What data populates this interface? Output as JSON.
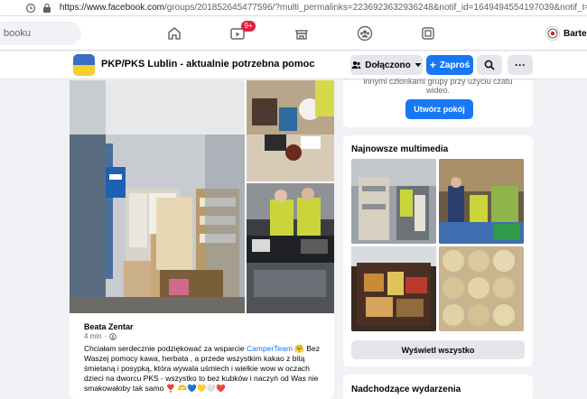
{
  "browser": {
    "url_prefix": "https://www.facebook.com",
    "url_rest": "/groups/201852645477596/?multi_permalinks=2236923632936248&notif_id=1649494554197039&notif_t=group_activity&ref=notif",
    "icons": [
      "history-icon",
      "lock-icon"
    ]
  },
  "topnav": {
    "search_placeholder": "booku",
    "watch_badge": "9+",
    "profile_name": "Bartek"
  },
  "group": {
    "title": "PKP/PKS Lublin - aktualnie potrzebna pomoc",
    "flag_colors": [
      "#3b6cc6",
      "#f5cf2a"
    ],
    "joined_label": "Dołączono",
    "invite_label": "Zaproś"
  },
  "post": {
    "author": "Beata Zentar",
    "time": "4 min",
    "text_before": "Chciałam serdecznie podziękować za wsparcie ",
    "mention": "CamperTeam",
    "text_after": " 🤗 Bez Waszej pomocy kawa, herbata , a przede wszystkim kakao z bitą śmietaną i posypką,  która wywala uśmiech i wielkie wow w oczach dzieci na dworcu PKS -  wszystko to bez kubków i naczyń od Was nie smakowałoby tak samo ",
    "hearts": "❣️ 🫶💙💛🤍❤️"
  },
  "sidebar": {
    "room_text_line1": "innymi członkami grupy przy użyciu czatu",
    "room_text_line2": "wideo.",
    "room_button": "Utwórz pokój",
    "media_title": "Najnowsze multimedia",
    "view_all": "Wyświetl wszystko",
    "events_title": "Nadchodzące wydarzenia"
  },
  "colors": {
    "accent": "#1877f2",
    "page_bg": "#f0f2f5",
    "badge": "#e41e3f"
  }
}
